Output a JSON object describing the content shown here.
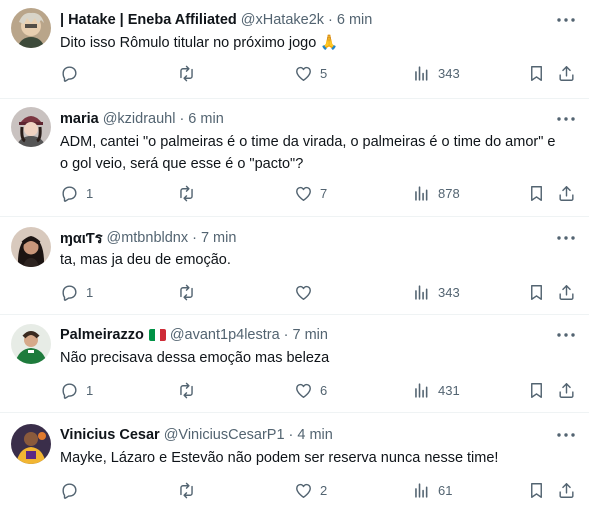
{
  "colors": {
    "text": "#0f1419",
    "muted": "#536471",
    "divider": "#eff3f4",
    "emoji_yellow": "#f6c344"
  },
  "tweets": [
    {
      "name": "| Hatake | Eneba Affiliated",
      "handle": "@xHatake2k",
      "dot": "·",
      "time": "6 min",
      "text_lines": [
        "Dito isso Rômulo titular no próximo jogo 🙏"
      ],
      "replies": "",
      "retweets": "",
      "likes": "5",
      "views": "343",
      "avatar": "avatar-anime-character",
      "flag": null
    },
    {
      "name": "maria",
      "handle": "@kzidrauhl",
      "dot": "·",
      "time": "6 min",
      "text_lines": [
        "ADM, cantei \"o palmeiras é o time da virada, o palmeiras é o time do amor\" e",
        "o gol veio, será que esse é o \"pacto\"?"
      ],
      "replies": "1",
      "retweets": "",
      "likes": "7",
      "views": "878",
      "avatar": "avatar-person-hat",
      "flag": null
    },
    {
      "name": "ɱαιƬร",
      "handle": "@mtbnbldnx",
      "dot": "·",
      "time": "7 min",
      "text_lines": [
        "ta, mas ja deu de emoção."
      ],
      "replies": "1",
      "retweets": "",
      "likes": "",
      "views": "343",
      "avatar": "avatar-person-dark-hair",
      "flag": null
    },
    {
      "name": "Palmeirazzo",
      "handle": "@avant1p4lestra",
      "dot": "·",
      "time": "7 min",
      "text_lines": [
        "Não precisava dessa emoção mas beleza"
      ],
      "replies": "1",
      "retweets": "",
      "likes": "6",
      "views": "431",
      "avatar": "avatar-green-jersey",
      "flag": "italy-flag"
    },
    {
      "name": "Vinicius Cesar",
      "handle": "@ViniciusCesarP1",
      "dot": "·",
      "time": "4 min",
      "text_lines": [
        "Mayke, Lázaro e Estevão não podem ser reserva nunca nesse time!"
      ],
      "replies": "",
      "retweets": "",
      "likes": "2",
      "views": "61",
      "avatar": "avatar-basketball-player",
      "flag": null
    }
  ]
}
